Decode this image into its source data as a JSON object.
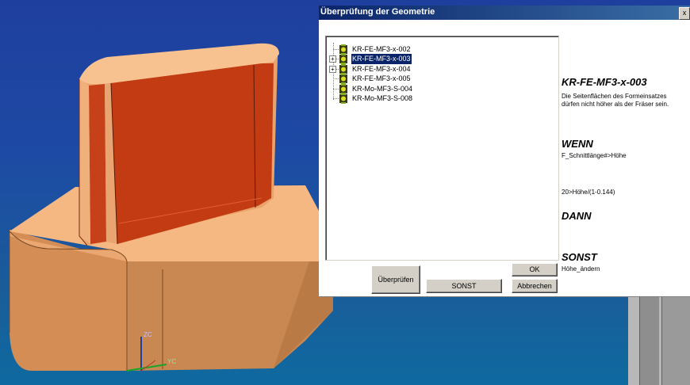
{
  "dialog": {
    "title": "Überprüfung der Geometrie",
    "close_label": "x"
  },
  "tree": {
    "items": [
      {
        "label": "KR-FE-MF3-x-002",
        "expandable": false,
        "selected": false
      },
      {
        "label": "KR-FE-MF3-x-003",
        "expandable": true,
        "selected": true
      },
      {
        "label": "KR-FE-MF3-x-004",
        "expandable": true,
        "selected": false
      },
      {
        "label": "KR-FE-MF3-x-005",
        "expandable": false,
        "selected": false
      },
      {
        "label": "KR-Mo-MF3-S-004",
        "expandable": false,
        "selected": false
      },
      {
        "label": "KR-Mo-MF3-S-008",
        "expandable": false,
        "selected": false
      }
    ],
    "expand_symbol": "+"
  },
  "rule": {
    "name": "KR-FE-MF3-x-003",
    "description_line1": "Die Seitenflächen des  Formeinsatzes",
    "description_line2": "dürfen nicht höher als der Fräser sein.",
    "wenn_label": "WENN",
    "wenn_value": "F_Schnittlänge#>Höhe",
    "formula": "20>Höhe/(1-0.144)",
    "dann_label": "DANN",
    "dann_value": "",
    "sonst_label": "SONST",
    "sonst_value": "Höhe_ändern"
  },
  "buttons": {
    "check": "Überprüfen",
    "sonst": "SONST",
    "ok": "OK",
    "cancel": "Abbrechen"
  },
  "viewport": {
    "axis_z": "ZC",
    "axis_y": "YC",
    "colors": {
      "background_top": "#1f3f9e",
      "background_bottom": "#0e6aa0",
      "part_light": "#f5b27e",
      "part_side": "#c98852",
      "highlight_face": "#c03a10",
      "axis_green": "#1aa52a"
    }
  }
}
